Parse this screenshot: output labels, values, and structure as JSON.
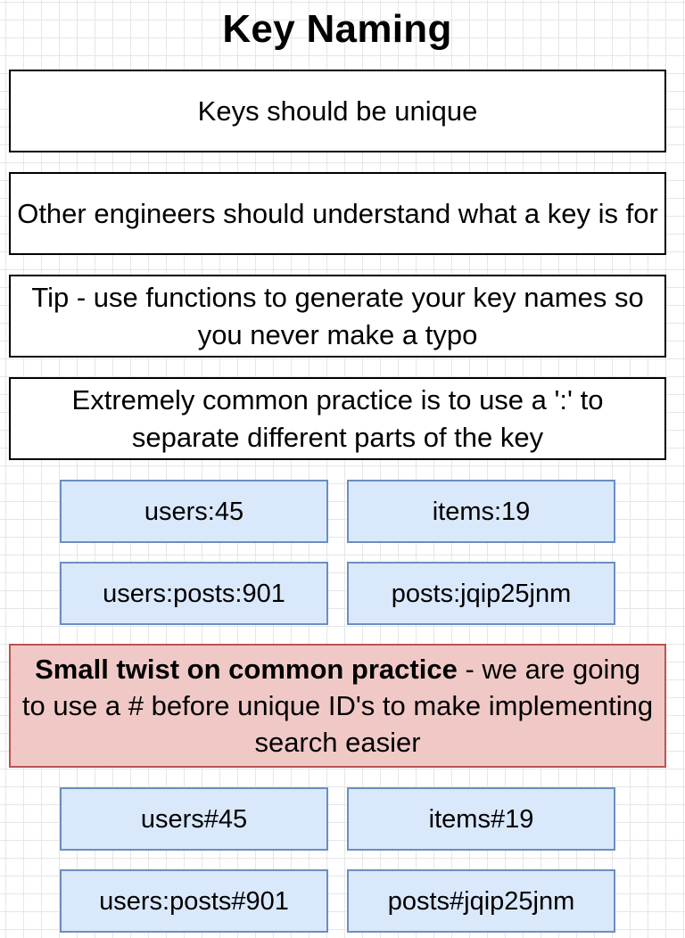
{
  "title": "Key Naming",
  "notes": [
    "Keys should be unique",
    "Other engineers should understand what a key is for",
    "Tip - use functions to generate your key names so you never make a typo",
    "Extremely common practice is to use a ':' to separate different parts of the key"
  ],
  "common_keys": [
    "users:45",
    "items:19",
    "users:posts:901",
    "posts:jqip25jnm"
  ],
  "twist": {
    "bold": "Small twist on common practice",
    "rest": " - we are going to use a # before unique ID's to make implementing search easier"
  },
  "hash_keys": [
    "users#45",
    "items#19",
    "users:posts#901",
    "posts#jqip25jnm"
  ],
  "colors": {
    "key_fill": "#dae8fc",
    "key_border": "#6c8ebf",
    "twist_fill": "#f0c9c7",
    "twist_border": "#b85450"
  }
}
